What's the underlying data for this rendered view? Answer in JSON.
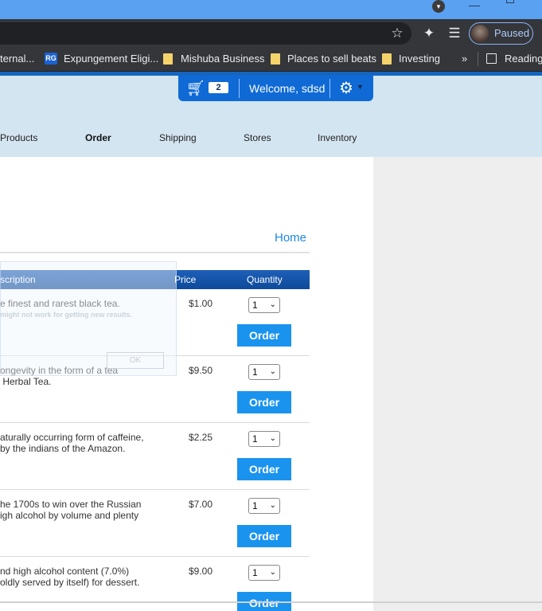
{
  "browser": {
    "profile_status": "Paused",
    "bookmarks": [
      "ternal...",
      "Expungement Eligi...",
      "Mishuba Business",
      "Places to sell beats",
      "Investing",
      "Reading"
    ],
    "bookmark_rg_label": "RG",
    "more_label": "»"
  },
  "site": {
    "cart_count": "2",
    "welcome": "Welcome, sdsd",
    "nav": [
      "Products",
      "Order",
      "Shipping",
      "Stores",
      "Inventory"
    ],
    "active_nav": "Order",
    "home_link": "Home"
  },
  "table": {
    "headers": {
      "description": "scription",
      "price": "Price",
      "quantity": "Quantity"
    },
    "rows": [
      {
        "description": "e finest and rarest black tea.",
        "price": "$1.00",
        "qty": "1",
        "order": "Order"
      },
      {
        "description": "ongevity in the form of a tea\n Herbal Tea.",
        "price": "$9.50",
        "qty": "1",
        "order": "Order"
      },
      {
        "description": "aturally occurring form of caffeine,\nby the indians of the Amazon.",
        "price": "$2.25",
        "qty": "1",
        "order": "Order"
      },
      {
        "description": "he 1700s to win over the Russian\nigh alcohol by volume and plenty",
        "price": "$7.00",
        "qty": "1",
        "order": "Order"
      },
      {
        "description": "nd high alcohol content (7.0%)\noldly served by itself) for dessert.",
        "price": "$9.00",
        "qty": "1",
        "order": "Order"
      }
    ]
  },
  "ghost_dialog": {
    "message": "might not work for getting new results.",
    "ok": "OK"
  },
  "colors": {
    "header_bg": "#d4e5f2",
    "accent": "#1a93ee",
    "table_header": "#1f5fb8"
  }
}
